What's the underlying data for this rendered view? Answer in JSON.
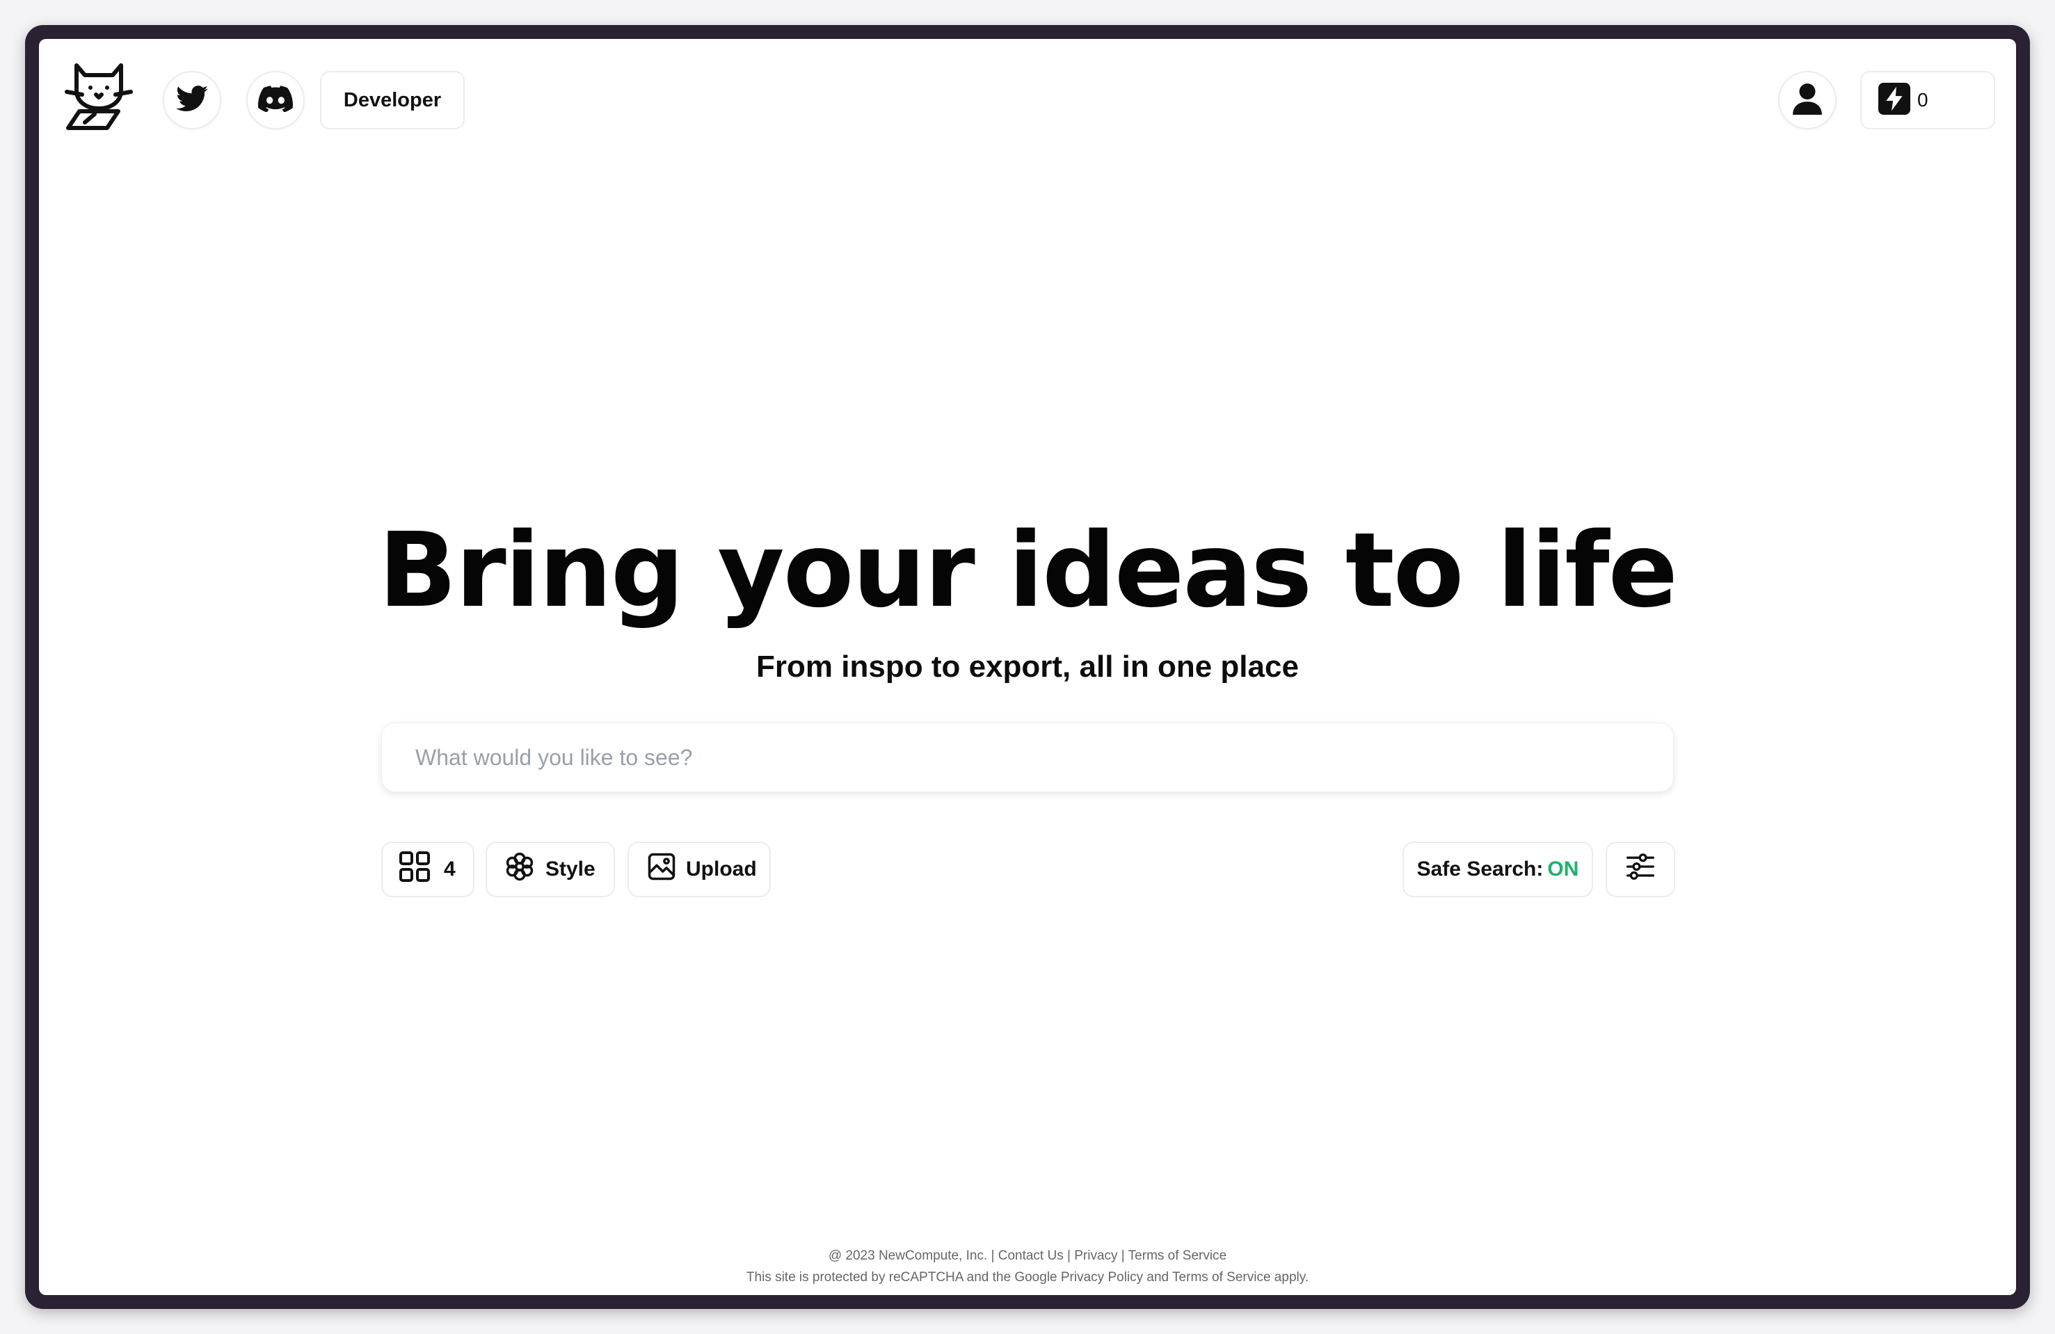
{
  "header": {
    "developer_label": "Developer",
    "credits_count": "0",
    "icons": [
      "cat-logo-icon",
      "twitter-icon",
      "discord-icon",
      "user-icon",
      "lightning-icon"
    ]
  },
  "hero": {
    "title": "Bring your ideas to life",
    "subtitle": "From inspo to export, all in one place"
  },
  "search": {
    "placeholder": "What would you like to see?",
    "value": ""
  },
  "controls": {
    "count_label": "4",
    "style_label": "Style",
    "upload_label": "Upload",
    "safe_search_label": "Safe Search:",
    "safe_search_value": "ON",
    "safe_search_color": "#1db36b"
  },
  "footer": {
    "copyright": "@ 2023 NewCompute, Inc.",
    "links": [
      "Contact Us",
      "Privacy",
      "Terms of Service"
    ],
    "recaptcha": "This site is protected by reCAPTCHA and the Google Privacy Policy and Terms of Service apply."
  }
}
